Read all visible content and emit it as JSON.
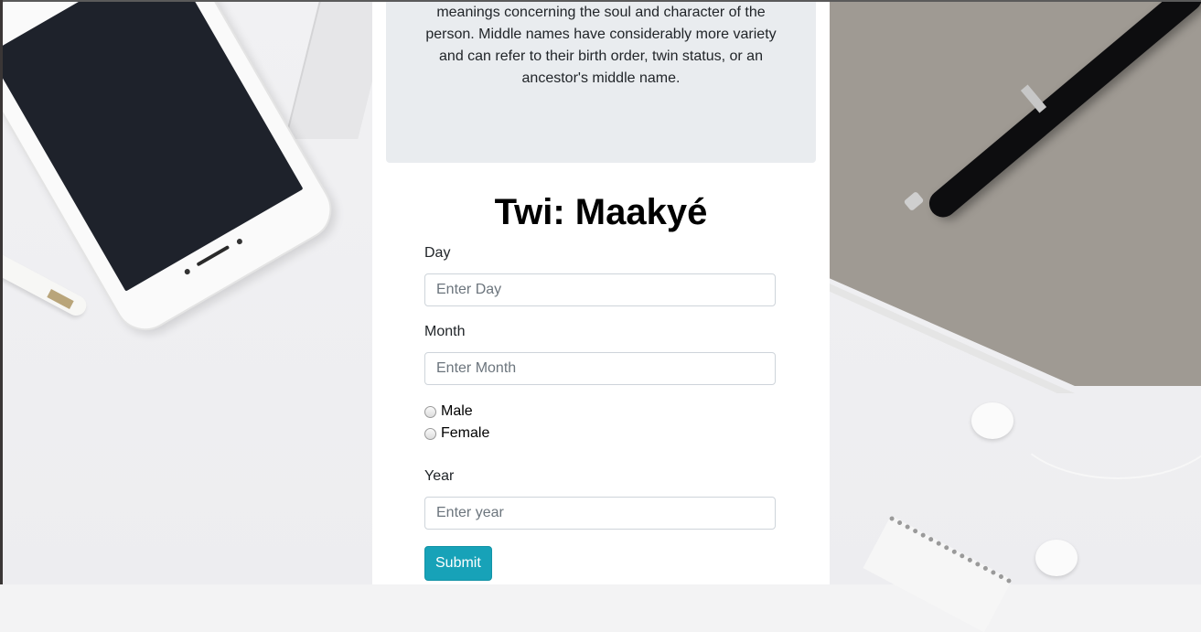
{
  "jumbotron": {
    "lines": [
      "meanings concerning the soul and character of the",
      "person. Middle names have considerably more variety",
      "and can refer to their birth order, twin status, or an",
      "ancestor's middle name."
    ]
  },
  "form": {
    "title": "Twi: Maakyé",
    "day_label": "Day",
    "day_placeholder": "Enter Day",
    "month_label": "Month",
    "month_placeholder": "Enter Month",
    "gender_options": [
      "Male",
      "Female"
    ],
    "year_label": "Year",
    "year_placeholder": "Enter year",
    "submit_label": "Submit"
  },
  "colors": {
    "accent": "#17a2b8",
    "jumbotron_bg": "#e9ecef"
  }
}
